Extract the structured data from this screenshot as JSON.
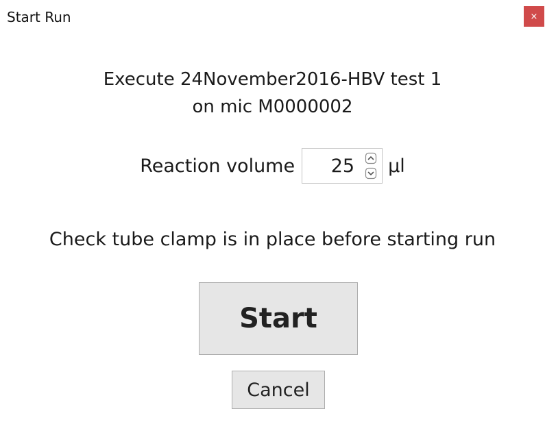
{
  "window": {
    "title": "Start Run",
    "close_label": "×"
  },
  "heading": {
    "line1": "Execute 24November2016-HBV test 1",
    "line2": "on mic M0000002"
  },
  "volume": {
    "label": "Reaction volume",
    "value": "25",
    "unit": "µl"
  },
  "instruction": "Check tube clamp is in place before starting run",
  "buttons": {
    "start": "Start",
    "cancel": "Cancel"
  },
  "colors": {
    "close_button": "#d04a4a",
    "button_face": "#e6e6e6",
    "button_border": "#adadad"
  }
}
